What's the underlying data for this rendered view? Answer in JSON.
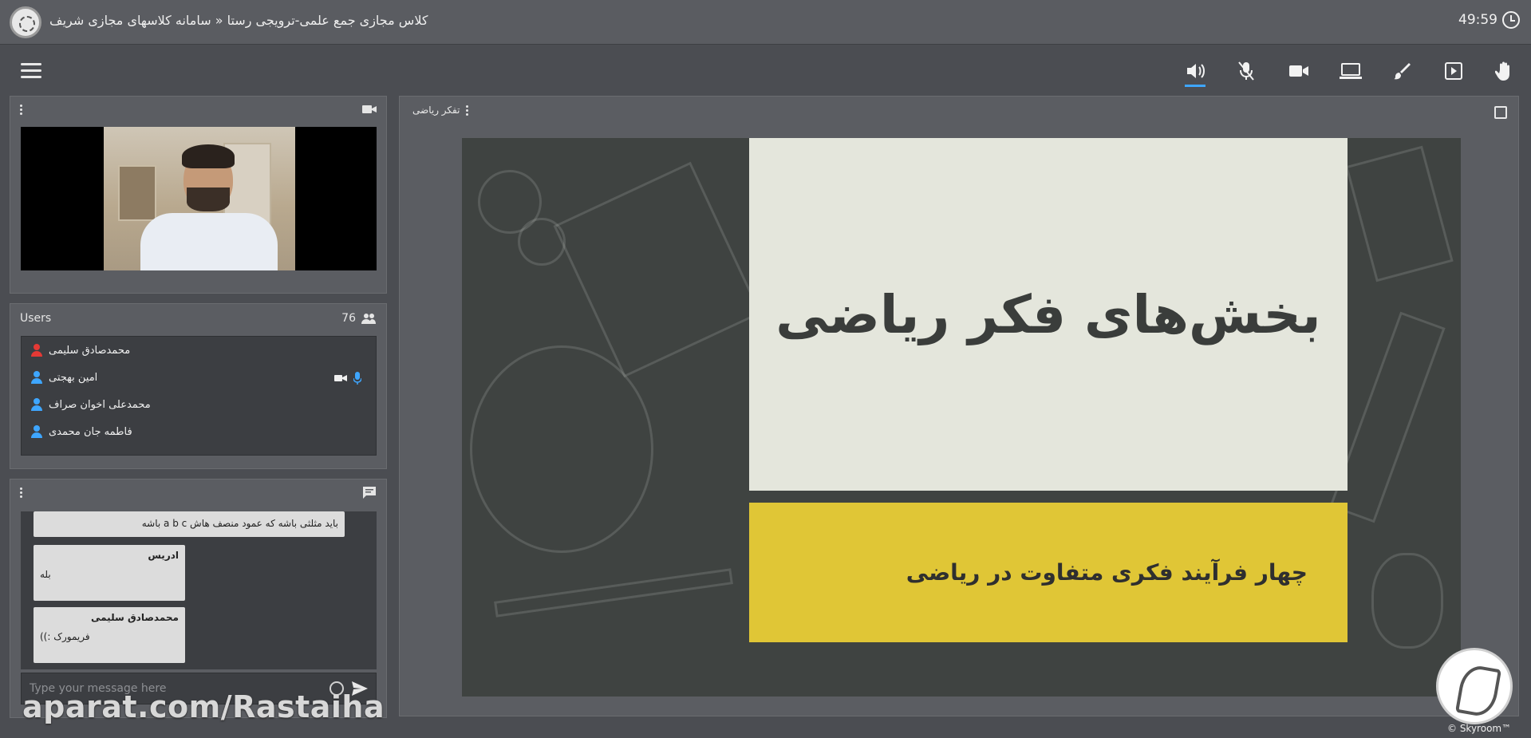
{
  "window": {
    "title": "کلاس مجازی جمع علمی-ترویجی رستا « سامانه کلاسهای مجازی شریف",
    "timer": "49:59"
  },
  "toolbar": {
    "tools": [
      "hand-icon",
      "play-screen-icon",
      "brush-icon",
      "laptop-icon",
      "camera-icon",
      "mic-off-icon",
      "speaker-icon"
    ]
  },
  "webcam_panel": {
    "header": ""
  },
  "users_panel": {
    "title": "Users",
    "count": "76",
    "users": [
      {
        "name": "محمدصادق سلیمی",
        "color": "#e53935"
      },
      {
        "name": "امین بهجتی",
        "color": "#3ea6ff"
      },
      {
        "name": "محمدعلی اخوان صراف",
        "color": "#3ea6ff"
      },
      {
        "name": "فاطمه جان محمدی",
        "color": "#3ea6ff"
      }
    ]
  },
  "chat_panel": {
    "messages": [
      {
        "name": "",
        "text": "باید مثلثی باشه که عمود منصف هاش a b c باشه"
      },
      {
        "name": "ادریس",
        "text": "بله"
      },
      {
        "name": "محمدصادق سلیمی",
        "text": "فریمورک :))"
      }
    ],
    "input_placeholder": "Type your message here"
  },
  "presentation": {
    "title": "تفکر ریاضی",
    "slide_title": "بخش‌های فکر ریاضی",
    "slide_subtitle": "چهار فرآیند فکری متفاوت در ریاضی"
  },
  "watermark": "aparat.com/Rastaiha",
  "brand": "© Skyroom™",
  "colors": {
    "accent": "#3ea6ff",
    "slide_yellow": "#e0c636",
    "slide_light": "#e4e6dc"
  }
}
